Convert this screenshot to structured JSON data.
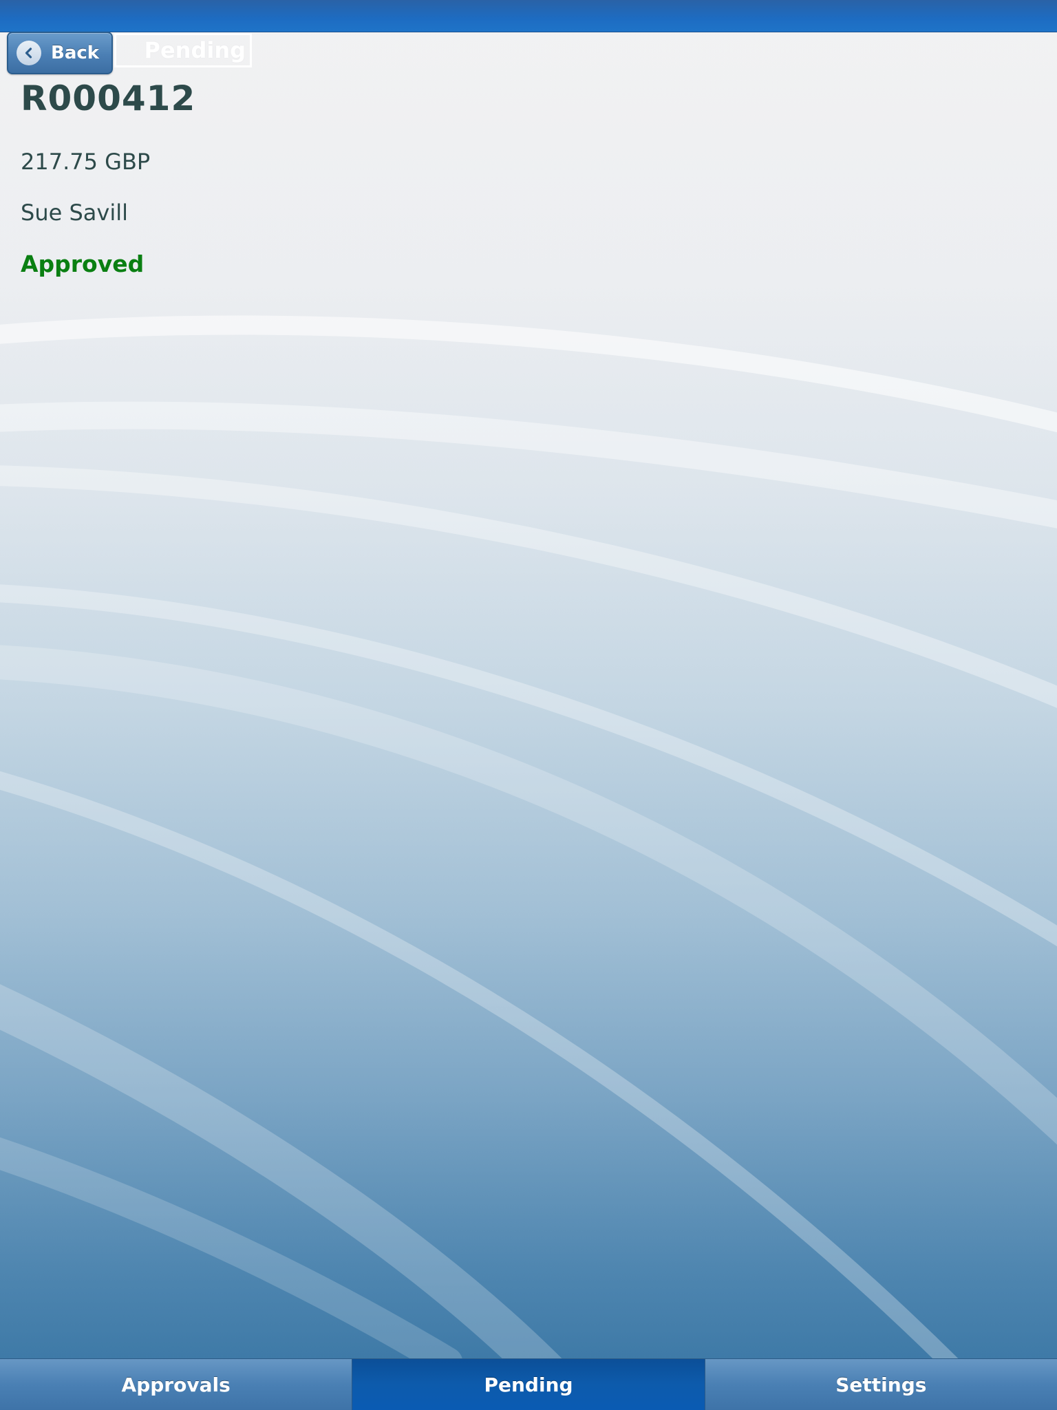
{
  "nav": {
    "back_label": "Back",
    "title": "Pending"
  },
  "record": {
    "id": "R000412",
    "amount": "217.75 GBP",
    "submitter": "Sue Savill",
    "status": "Approved",
    "status_color": "#0a7f12"
  },
  "tabs": [
    {
      "label": "Approvals",
      "active": false
    },
    {
      "label": "Pending",
      "active": true
    },
    {
      "label": "Settings",
      "active": false
    }
  ]
}
